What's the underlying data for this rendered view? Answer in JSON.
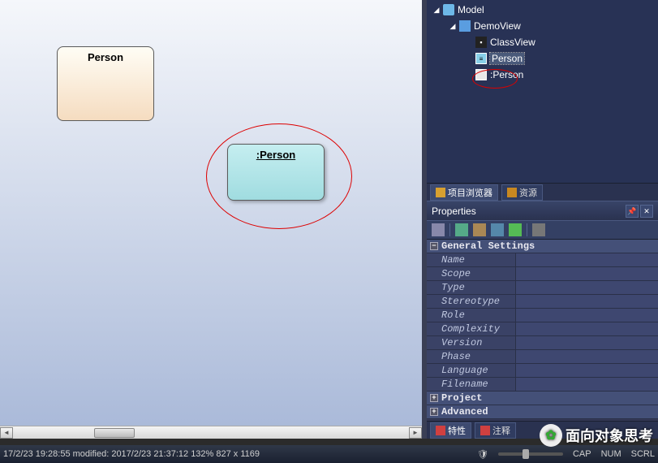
{
  "tree": {
    "root": "Model",
    "child": "DemoView",
    "items": [
      "ClassView",
      "Person",
      ":Person"
    ]
  },
  "tree_tabs": {
    "t1": "项目浏览器",
    "t2": "资源"
  },
  "canvas": {
    "class_label": "Person",
    "object_label": ":Person"
  },
  "properties": {
    "title": "Properties",
    "groups": {
      "general": "General Settings",
      "project": "Project",
      "advanced": "Advanced"
    },
    "fields": [
      "Name",
      "Scope",
      "Type",
      "Stereotype",
      "Role",
      "Complexity",
      "Version",
      "Phase",
      "Language",
      "Filename"
    ]
  },
  "props_tabs": {
    "t1": "特性",
    "t2": "注释"
  },
  "status": {
    "left": "17/2/23 19:28:55   modified: 2017/2/23 21:37:12   132%    827 x 1169",
    "cap": "CAP",
    "num": "NUM",
    "scrl": "SCRL"
  },
  "watermark": "面向对象思考"
}
